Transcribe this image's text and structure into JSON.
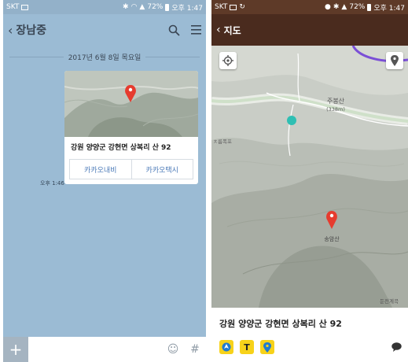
{
  "left": {
    "status": {
      "carrier": "SKT",
      "battery": "72%",
      "time": "오후 1:47"
    },
    "header": {
      "title": "장남중"
    },
    "date_divider": "2017년 6월 8일 목요일",
    "message": {
      "address": "강원 양양군 강현면 상복리 산 92",
      "button_kakaonavi": "카카오내비",
      "button_kakaotaxi": "카카오택시",
      "time": "오후 1:46"
    },
    "input": {
      "plus": "+",
      "hash": "#"
    }
  },
  "right": {
    "status": {
      "carrier": "SKT",
      "battery": "72%",
      "time": "오후 1:47"
    },
    "header": {
      "title": "지도"
    },
    "map_labels": {
      "mountain1": "주봉산",
      "elev1": "(338m)",
      "mountain2": "송암산",
      "sign1": "ㅊ름폭포",
      "sign2": "둔전계곡"
    },
    "address": "강원 양양군 강현면 상복리 산 92"
  },
  "colors": {
    "kakao_yellow": "#f7d21a",
    "marker_red": "#e63b2e",
    "header_brown": "#4a2b1e"
  }
}
